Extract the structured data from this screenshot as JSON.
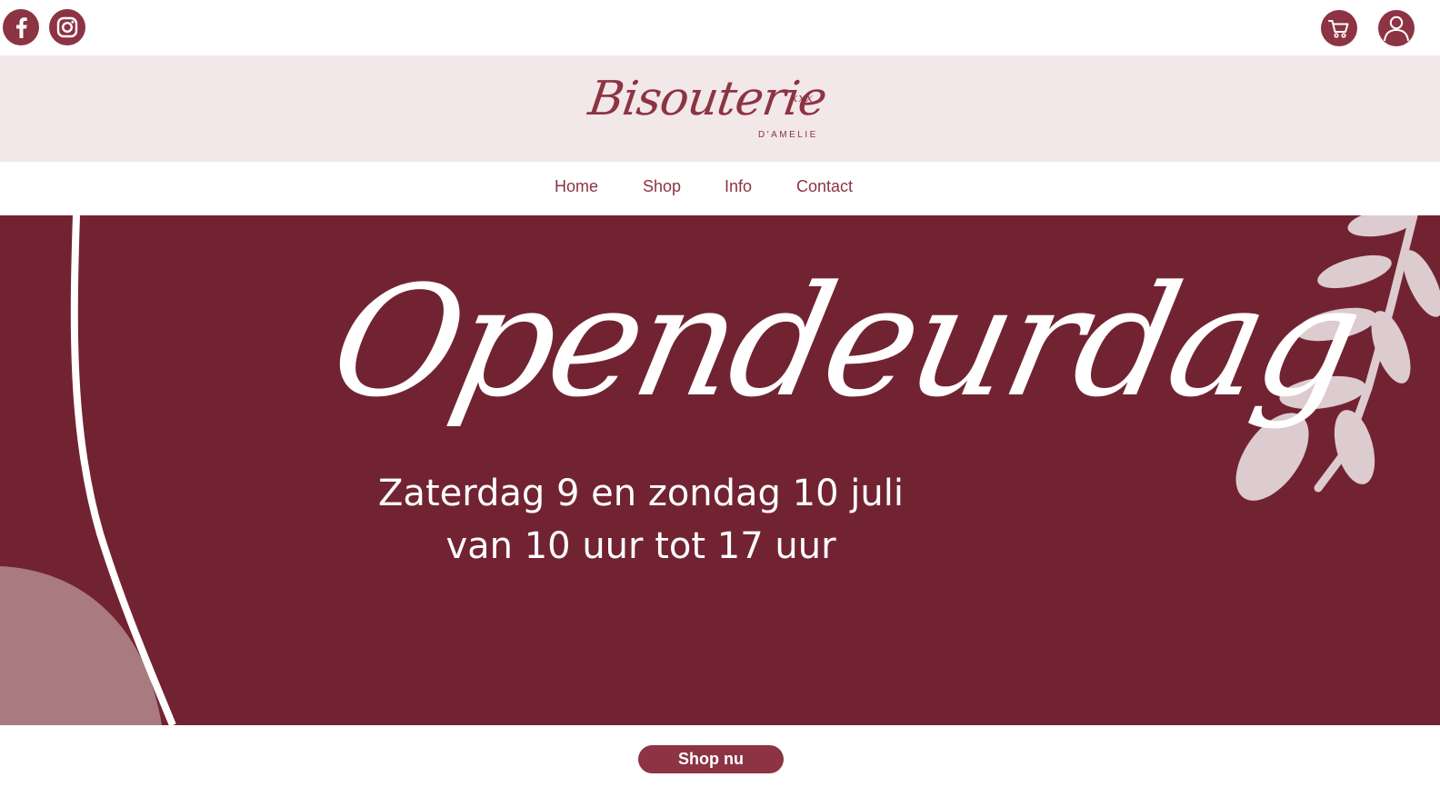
{
  "social": {
    "facebook_icon": "facebook-icon",
    "instagram_icon": "instagram-icon"
  },
  "account": {
    "cart_icon": "cart-icon",
    "user_icon": "user-icon"
  },
  "brand": {
    "name": "Bisouterie",
    "kisses": "xxx",
    "sub": "D'AMELIE"
  },
  "nav": {
    "items": [
      {
        "label": "Home"
      },
      {
        "label": "Shop"
      },
      {
        "label": "Info"
      },
      {
        "label": "Contact"
      }
    ]
  },
  "hero": {
    "title": "Opendeurdag",
    "line1": "Zaterdag 9 en zondag 10 juli",
    "line2": "van 10 uur tot 17 uur"
  },
  "cta": {
    "label": "Shop nu"
  },
  "colors": {
    "brand": "#8c3344",
    "hero_bg": "#722332",
    "logo_band": "#f2e7e9",
    "leaf": "#dccbcf",
    "blob": "#a97a80"
  }
}
